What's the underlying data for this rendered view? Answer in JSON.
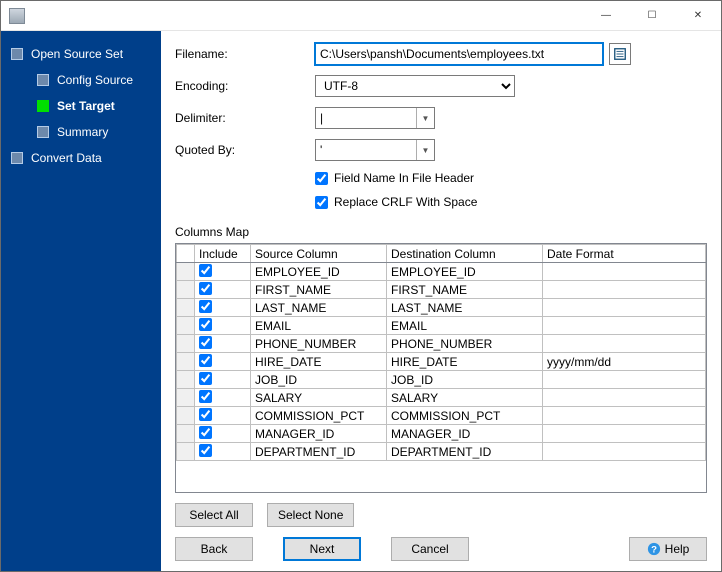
{
  "window": {
    "minimize_glyph": "—",
    "maximize_glyph": "☐",
    "close_glyph": "✕"
  },
  "sidebar": {
    "items": [
      {
        "label": "Open Source Set",
        "indent": false,
        "active": false
      },
      {
        "label": "Config Source",
        "indent": true,
        "active": false
      },
      {
        "label": "Set Target",
        "indent": true,
        "active": true
      },
      {
        "label": "Summary",
        "indent": true,
        "active": false
      },
      {
        "label": "Convert Data",
        "indent": false,
        "active": false
      }
    ]
  },
  "form": {
    "filename_label": "Filename:",
    "filename_value": "C:\\Users\\pansh\\Documents\\employees.txt",
    "encoding_label": "Encoding:",
    "encoding_value": "UTF-8",
    "delimiter_label": "Delimiter:",
    "delimiter_value": "|",
    "quoted_label": "Quoted By:",
    "quoted_value": "'",
    "header_checkbox": "Field Name In File Header",
    "crlf_checkbox": "Replace CRLF With Space",
    "header_checked": true,
    "crlf_checked": true
  },
  "columns_map": {
    "label": "Columns Map",
    "headers": {
      "include": "Include",
      "source": "Source Column",
      "dest": "Destination Column",
      "format": "Date Format"
    },
    "rows": [
      {
        "include": true,
        "source": "EMPLOYEE_ID",
        "dest": "EMPLOYEE_ID",
        "format": ""
      },
      {
        "include": true,
        "source": "FIRST_NAME",
        "dest": "FIRST_NAME",
        "format": ""
      },
      {
        "include": true,
        "source": "LAST_NAME",
        "dest": "LAST_NAME",
        "format": ""
      },
      {
        "include": true,
        "source": "EMAIL",
        "dest": "EMAIL",
        "format": ""
      },
      {
        "include": true,
        "source": "PHONE_NUMBER",
        "dest": "PHONE_NUMBER",
        "format": ""
      },
      {
        "include": true,
        "source": "HIRE_DATE",
        "dest": "HIRE_DATE",
        "format": "yyyy/mm/dd"
      },
      {
        "include": true,
        "source": "JOB_ID",
        "dest": "JOB_ID",
        "format": ""
      },
      {
        "include": true,
        "source": "SALARY",
        "dest": "SALARY",
        "format": ""
      },
      {
        "include": true,
        "source": "COMMISSION_PCT",
        "dest": "COMMISSION_PCT",
        "format": ""
      },
      {
        "include": true,
        "source": "MANAGER_ID",
        "dest": "MANAGER_ID",
        "format": ""
      },
      {
        "include": true,
        "source": "DEPARTMENT_ID",
        "dest": "DEPARTMENT_ID",
        "format": ""
      }
    ]
  },
  "buttons": {
    "select_all": "Select All",
    "select_none": "Select None",
    "back": "Back",
    "next": "Next",
    "cancel": "Cancel",
    "help": "Help"
  }
}
